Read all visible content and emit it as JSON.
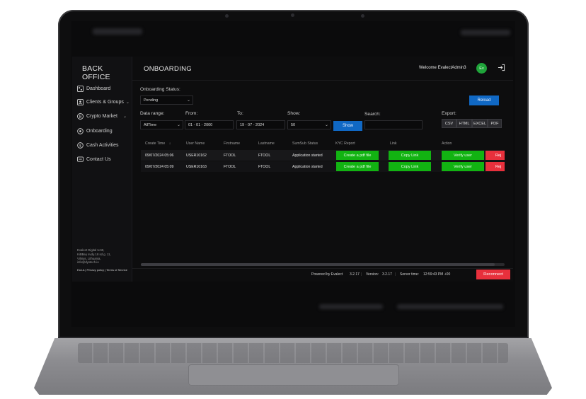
{
  "sidebar": {
    "brand": "BACK OFFICE",
    "items": [
      {
        "label": "Dashboard",
        "icon": "dashboard-icon",
        "chevron": false
      },
      {
        "label": "Clients & Groups",
        "icon": "users-icon",
        "chevron": true
      },
      {
        "label": "Crypto Market",
        "icon": "bitcoin-icon",
        "chevron": true
      },
      {
        "label": "Onboarding",
        "icon": "circle-icon",
        "chevron": false
      },
      {
        "label": "Cash Activities",
        "icon": "cash-icon",
        "chevron": false
      },
      {
        "label": "Contact Us",
        "icon": "chat-icon",
        "chevron": false
      }
    ],
    "company_address": "Evalect Digital UAB,\nKiBBey svdų 18 sd g. 11,\nVilnius, Lithuania,\ninfo@dystech.io",
    "footer_links": "EULA | Privacy policy | Terms of Service"
  },
  "header": {
    "title": "ONBOARDING",
    "welcome": "Welcome EvalectAdmin3",
    "avatar_initials": "Ev"
  },
  "filters": {
    "onboarding_status_label": "Onboarding Status:",
    "onboarding_status_value": "Pending",
    "reload_label": "Reload",
    "date_range_label": "Data range:",
    "date_range_value": "AllTime",
    "from_label": "From:",
    "from_value": "01 - 01 - 2000",
    "to_label": "To:",
    "to_value": "19 - 07 - 2024",
    "show_label": "Show:",
    "show_value": "50",
    "show_button": "Show",
    "search_label": "Search:",
    "search_value": "",
    "export_label": "Export:",
    "export_buttons": [
      "CSV",
      "HTML",
      "EXCEL",
      "PDF"
    ]
  },
  "table": {
    "columns": [
      "Create Time",
      "User Name",
      "Firstname",
      "Lastname",
      "SumSub Status",
      "KYC Report",
      "Link",
      "Action"
    ],
    "rows": [
      {
        "create_time": "09/07/2024 05:06",
        "user_name": "USER10162",
        "firstname": "FTOOL",
        "lastname": "FTOOL",
        "status": "Application started",
        "kyc": "Create a pdf file",
        "link": "Copy Link",
        "verify": "Verify user",
        "reject": "Rej"
      },
      {
        "create_time": "09/07/2024 05:09",
        "user_name": "USER10163",
        "firstname": "FTOOL",
        "lastname": "FTOOL",
        "status": "Application started",
        "kyc": "Create a pdf file",
        "link": "Copy Link",
        "verify": "Verify user",
        "reject": "Rej"
      }
    ]
  },
  "statusbar": {
    "powered": "Powered by Evalect",
    "powered_version": "3.2.17",
    "version_label": "Version:",
    "version_value": "3.2.17",
    "server_time_label": "Server time:",
    "server_time_value": "12:59:43 PM +00",
    "reconnect_label": "Reconnect"
  },
  "colors": {
    "green": "#12b312",
    "red": "#e8303c",
    "blue": "#1068c4",
    "background": "#0d0d0e"
  }
}
